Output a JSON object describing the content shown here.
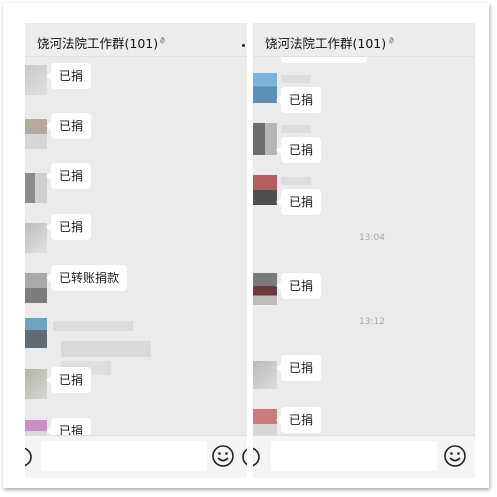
{
  "chat": {
    "group_title": "饶河法院工作群(101)",
    "icons": {
      "mute": "bell-muted-icon",
      "more": "more-dot-icon",
      "emoji": "emoji-icon",
      "voice": "voice-icon"
    }
  },
  "left_panel": {
    "messages": [
      {
        "text": "已捐"
      },
      {
        "text": "已捐"
      },
      {
        "text": "已捐"
      },
      {
        "text": "已捐"
      },
      {
        "text": "已转账捐款"
      },
      {
        "text": "已捐"
      },
      {
        "text": "已捐"
      }
    ]
  },
  "right_panel": {
    "messages_before": [
      {
        "text": "已捐"
      },
      {
        "text": "已捐"
      },
      {
        "text": "已捐"
      }
    ],
    "time_1": "13:04",
    "message_after_time_1": {
      "text": "已捐"
    },
    "time_2": "13:12",
    "messages_after_time_2": [
      {
        "text": "已捐"
      },
      {
        "text": "已捐"
      }
    ]
  },
  "colors": {
    "chat_background": "#ebebeb",
    "bubble_background": "#ffffff",
    "input_bar": "#f4f4f4",
    "timestamp_text": "#a8a8a8"
  }
}
